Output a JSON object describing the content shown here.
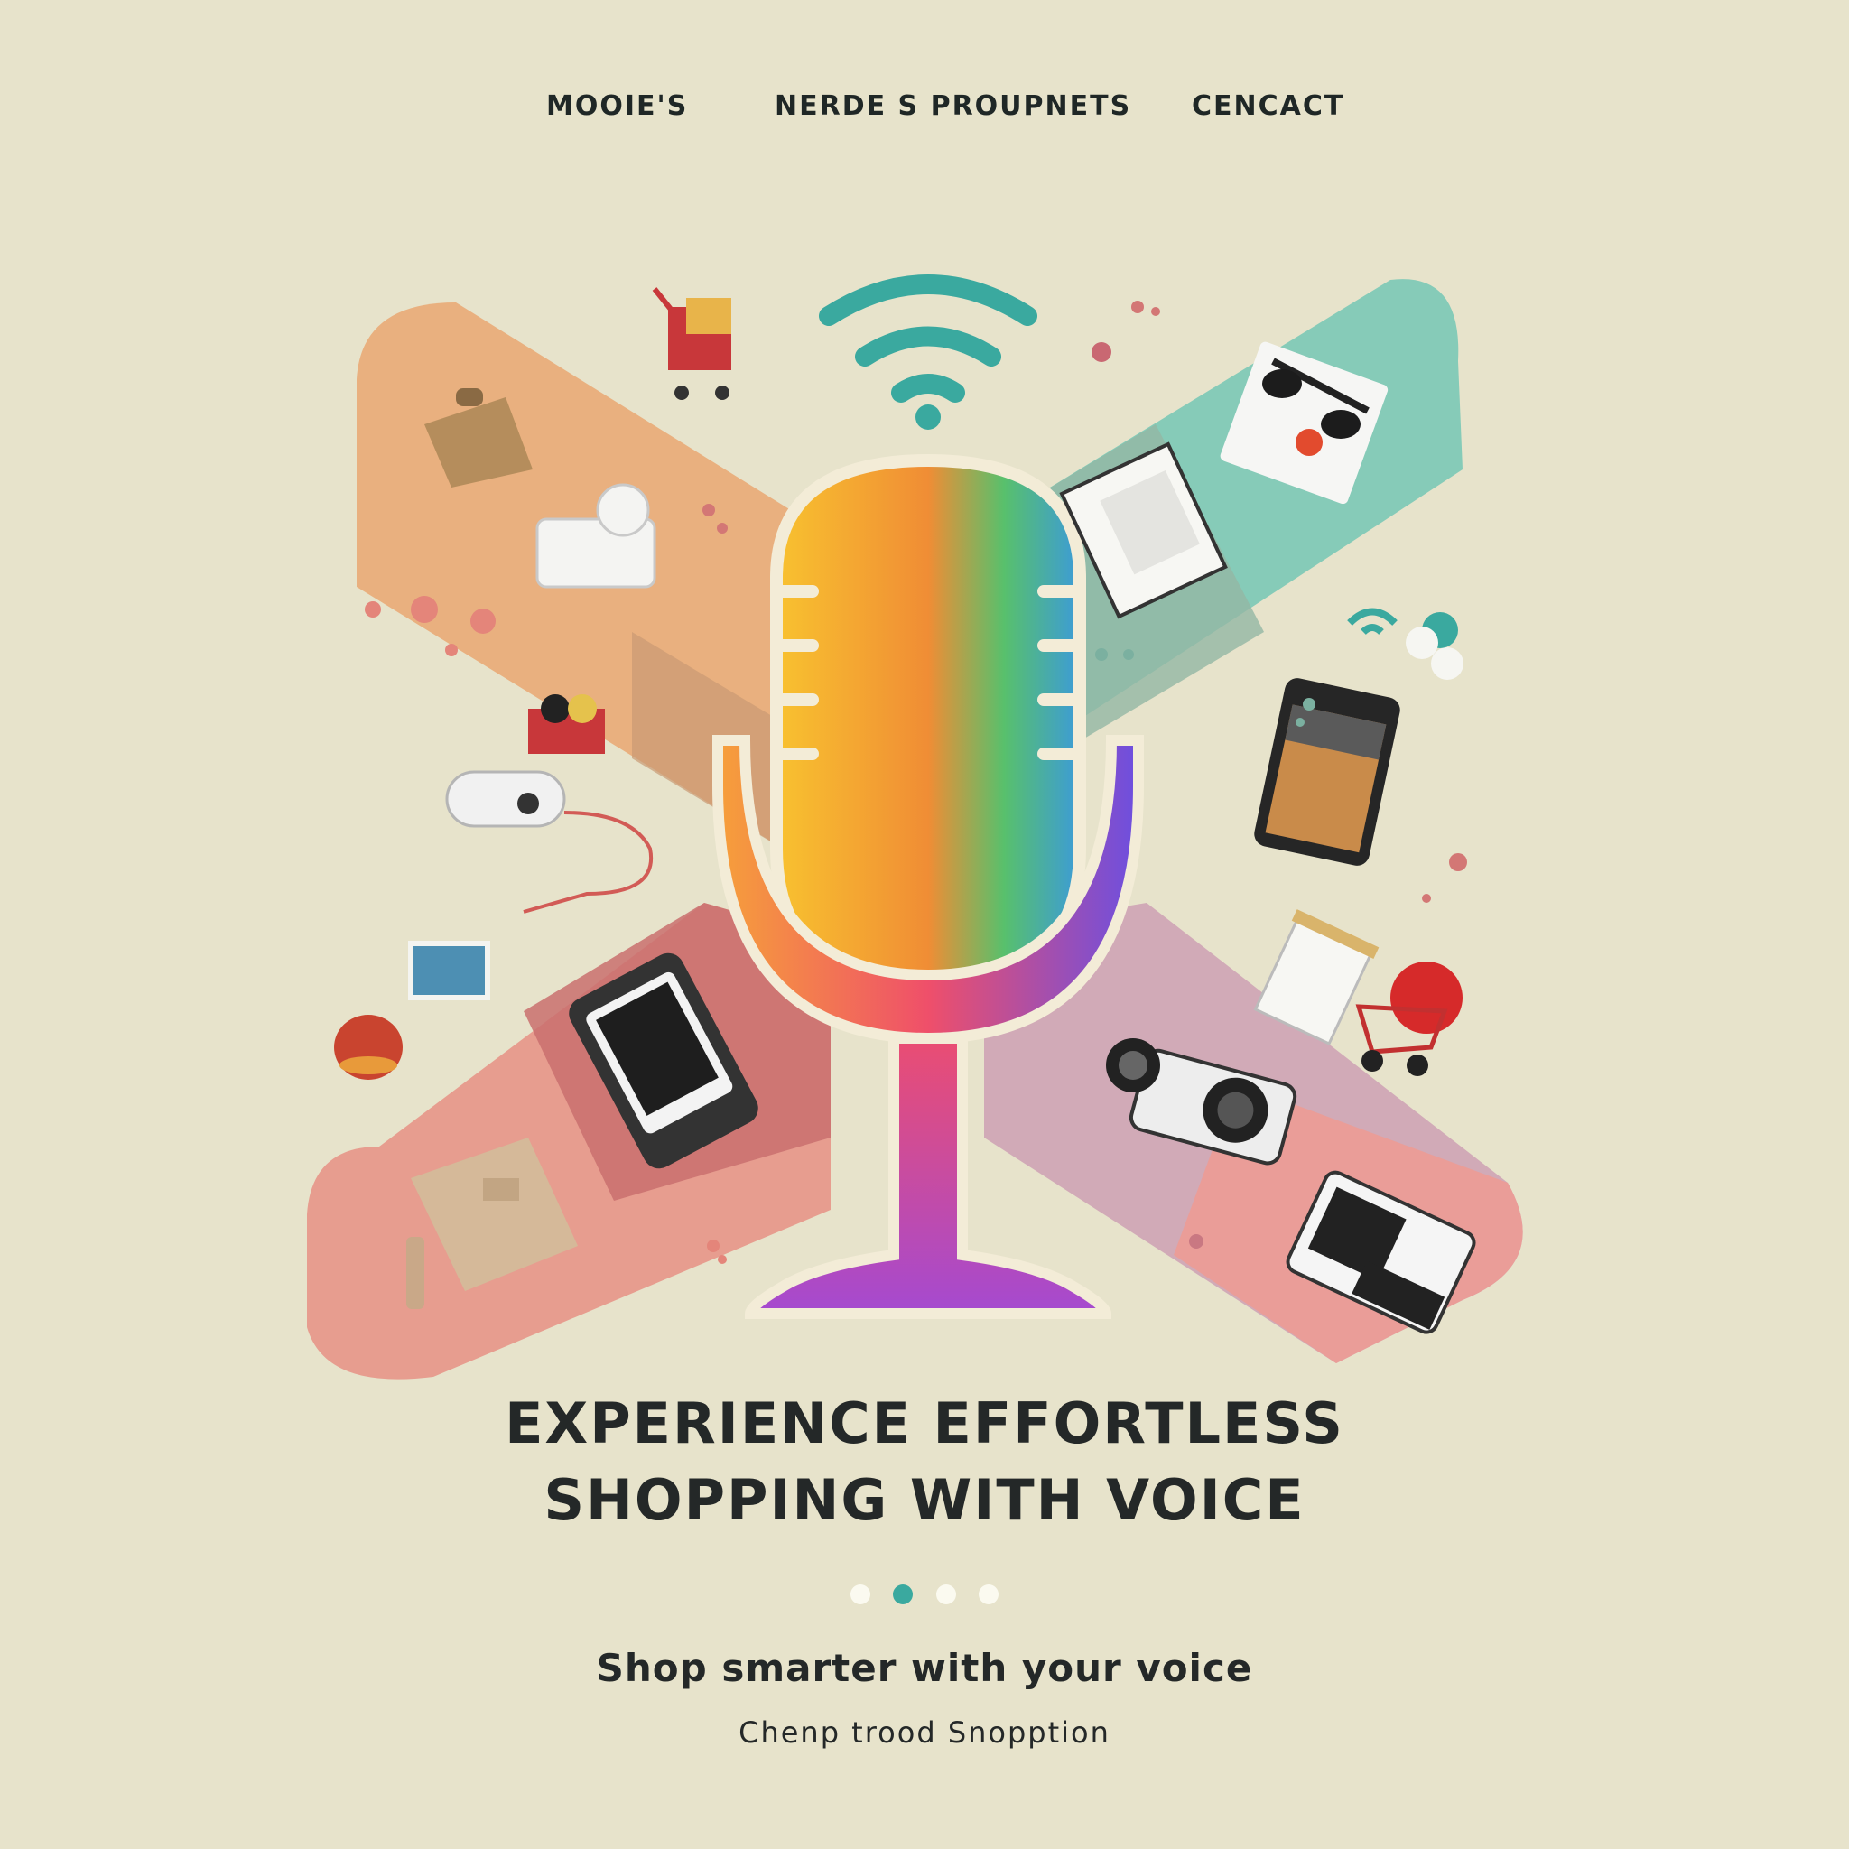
{
  "nav": {
    "items": [
      {
        "label": "MOOIE'S"
      },
      {
        "label": "NERDE S  PROUPNETS"
      },
      {
        "label": "CENCACT"
      }
    ]
  },
  "hero": {
    "headline_line1": "EXPERIENCE EFFORTLESS",
    "headline_line2": "SHOPPING WITH VOICE",
    "tagline": "Shop smarter  with your voice",
    "subline": "Chenp trood  Snopption",
    "carousel": {
      "count": 4,
      "active_index": 1
    }
  },
  "colors": {
    "background": "#e7e3cb",
    "accent": "#3aa99f",
    "text": "#242828",
    "band_orange": "#e9b07f",
    "band_teal": "#86cbb8",
    "band_rose": "#e79d8f",
    "band_lilac": "#d1aab7"
  },
  "icons": [
    "microphone-icon",
    "wifi-signal-icon",
    "shopping-cart-icon",
    "backpack-icon",
    "smartphone-icon",
    "tablet-icon",
    "camera-icon",
    "sunglasses-icon",
    "notebook-icon",
    "speaker-icon",
    "wallet-icon"
  ]
}
